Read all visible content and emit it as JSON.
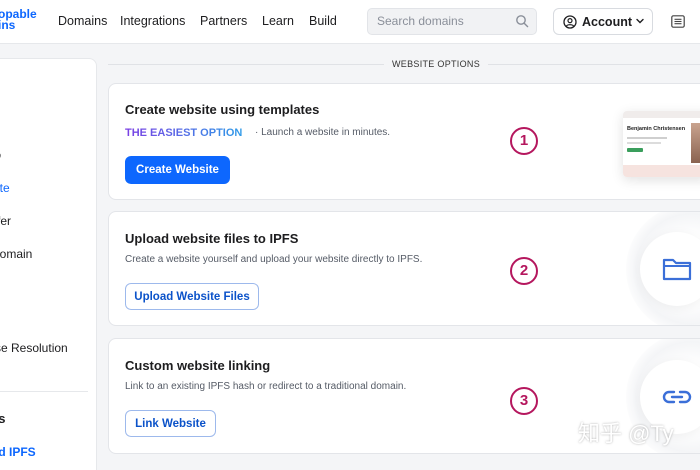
{
  "header": {
    "logo_lines": [
      "opable",
      "ins"
    ],
    "nav": [
      "Domains",
      "Integrations",
      "Partners",
      "Learn",
      "Build"
    ],
    "search": {
      "placeholder": "Search domains"
    },
    "account_label": "Account"
  },
  "sidebar": {
    "items": [
      {
        "label": "e"
      },
      {
        "label": "to"
      },
      {
        "label": "site",
        "active": true
      },
      {
        "label": "sfer"
      },
      {
        "label": "Domain"
      },
      {
        "label": "e"
      },
      {
        "label": ""
      },
      {
        "label": "rse Resolution"
      }
    ],
    "heading": "es",
    "link": "nd IPFS"
  },
  "section": {
    "title": "WEBSITE OPTIONS"
  },
  "cards": [
    {
      "number": "1",
      "title": "Create website using templates",
      "highlight": "THE EASIEST OPTION",
      "note": "·  Launch a website in minutes.",
      "button": "Create Website",
      "preview_name": "Benjamin Christensen"
    },
    {
      "number": "2",
      "title": "Upload website files to IPFS",
      "description": "Create a website yourself and upload your website directly to IPFS.",
      "button": "Upload Website Files",
      "icon": "folder-icon"
    },
    {
      "number": "3",
      "title": "Custom website linking",
      "description": "Link to an existing IPFS hash or redirect to a traditional domain.",
      "button": "Link Website",
      "icon": "link-icon"
    }
  ],
  "watermark": "知乎 @Ty",
  "colors": {
    "accent": "#0d67fe",
    "number_badge": "#b5175e",
    "gradient_start": "#7b3fe4",
    "gradient_end": "#2f9be8"
  }
}
